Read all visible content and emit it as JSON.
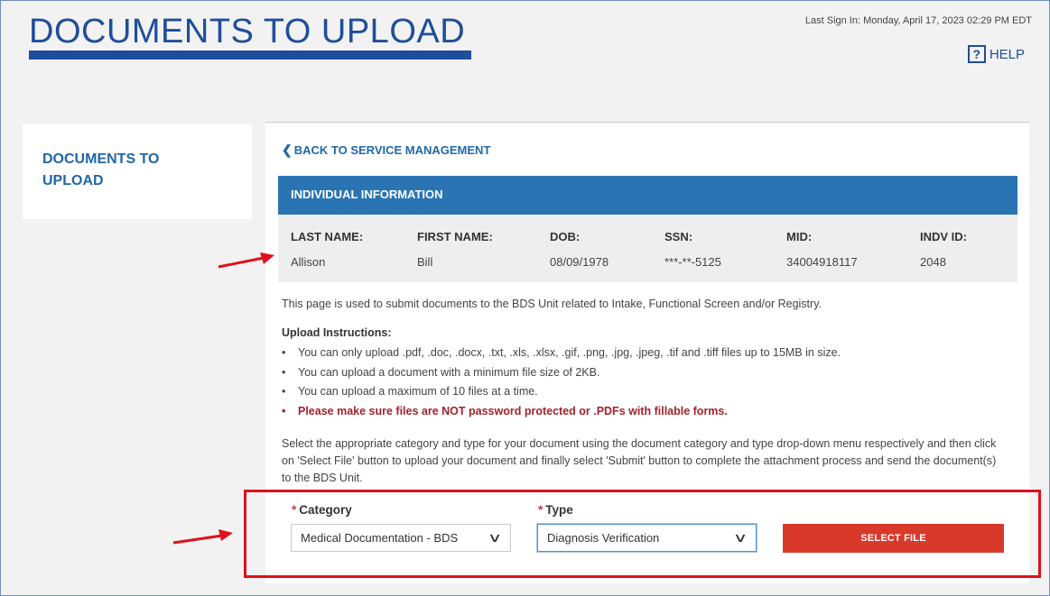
{
  "header": {
    "title": "DOCUMENTS TO UPLOAD",
    "last_sign_in": "Last Sign In: Monday, April 17, 2023 02:29 PM EDT",
    "help_label": "HELP",
    "help_icon": "?"
  },
  "sidebar": {
    "title": "DOCUMENTS TO UPLOAD"
  },
  "main": {
    "back_link": "BACK TO SERVICE MANAGEMENT",
    "info_header": "INDIVIDUAL INFORMATION",
    "info_columns": [
      {
        "label": "LAST NAME:",
        "value": "Allison"
      },
      {
        "label": "FIRST NAME:",
        "value": "Bill"
      },
      {
        "label": "DOB:",
        "value": "08/09/1978"
      },
      {
        "label": "SSN:",
        "value": "***-**-5125"
      },
      {
        "label": "MID:",
        "value": "34004918117"
      },
      {
        "label": "INDV ID:",
        "value": "2048"
      }
    ],
    "intro": "This page is used to submit documents to the BDS Unit related to Intake, Functional Screen and/or Registry.",
    "instructions_title": "Upload Instructions:",
    "instructions": [
      "You can only upload .pdf, .doc, .docx, .txt, .xls, .xlsx, .gif, .png, .jpg, .jpeg, .tif and .tiff files up to 15MB in size.",
      "You can upload a document with a minimum file size of 2KB.",
      "You can upload a maximum of 10 files at a time.",
      "Please make sure files are NOT password protected or .PDFs with fillable forms."
    ],
    "select_paragraph": "Select the appropriate category and type for your document using the document category and type drop-down menu respectively and then click on 'Select File' button to upload your document and finally select 'Submit' button to complete the attachment process and send the document(s) to the BDS Unit."
  },
  "form": {
    "required_mark": "*",
    "category_label": "Category",
    "category_value": "Medical Documentation - BDS",
    "type_label": "Type",
    "type_value": "Diagnosis Verification",
    "select_file_label": "SELECT FILE"
  },
  "colors": {
    "brand_blue": "#1f4e9a",
    "header_blue": "#2a74b4",
    "accent_red": "#d9392a",
    "annotation_red": "#e0101a"
  }
}
